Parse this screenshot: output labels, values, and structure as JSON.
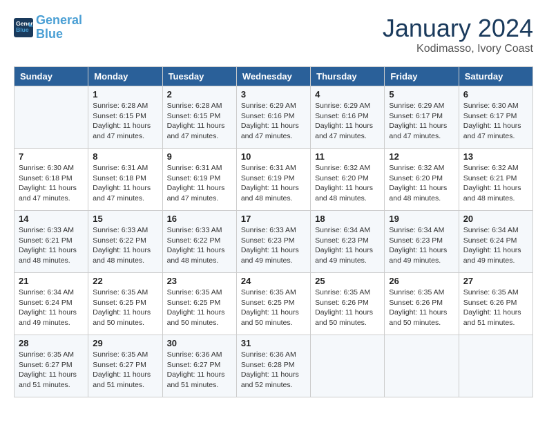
{
  "header": {
    "logo_line1": "General",
    "logo_line2": "Blue",
    "month": "January 2024",
    "location": "Kodimasso, Ivory Coast"
  },
  "weekdays": [
    "Sunday",
    "Monday",
    "Tuesday",
    "Wednesday",
    "Thursday",
    "Friday",
    "Saturday"
  ],
  "weeks": [
    [
      {
        "day": "",
        "info": ""
      },
      {
        "day": "1",
        "info": "Sunrise: 6:28 AM\nSunset: 6:15 PM\nDaylight: 11 hours\nand 47 minutes."
      },
      {
        "day": "2",
        "info": "Sunrise: 6:28 AM\nSunset: 6:15 PM\nDaylight: 11 hours\nand 47 minutes."
      },
      {
        "day": "3",
        "info": "Sunrise: 6:29 AM\nSunset: 6:16 PM\nDaylight: 11 hours\nand 47 minutes."
      },
      {
        "day": "4",
        "info": "Sunrise: 6:29 AM\nSunset: 6:16 PM\nDaylight: 11 hours\nand 47 minutes."
      },
      {
        "day": "5",
        "info": "Sunrise: 6:29 AM\nSunset: 6:17 PM\nDaylight: 11 hours\nand 47 minutes."
      },
      {
        "day": "6",
        "info": "Sunrise: 6:30 AM\nSunset: 6:17 PM\nDaylight: 11 hours\nand 47 minutes."
      }
    ],
    [
      {
        "day": "7",
        "info": "Sunrise: 6:30 AM\nSunset: 6:18 PM\nDaylight: 11 hours\nand 47 minutes."
      },
      {
        "day": "8",
        "info": "Sunrise: 6:31 AM\nSunset: 6:18 PM\nDaylight: 11 hours\nand 47 minutes."
      },
      {
        "day": "9",
        "info": "Sunrise: 6:31 AM\nSunset: 6:19 PM\nDaylight: 11 hours\nand 47 minutes."
      },
      {
        "day": "10",
        "info": "Sunrise: 6:31 AM\nSunset: 6:19 PM\nDaylight: 11 hours\nand 48 minutes."
      },
      {
        "day": "11",
        "info": "Sunrise: 6:32 AM\nSunset: 6:20 PM\nDaylight: 11 hours\nand 48 minutes."
      },
      {
        "day": "12",
        "info": "Sunrise: 6:32 AM\nSunset: 6:20 PM\nDaylight: 11 hours\nand 48 minutes."
      },
      {
        "day": "13",
        "info": "Sunrise: 6:32 AM\nSunset: 6:21 PM\nDaylight: 11 hours\nand 48 minutes."
      }
    ],
    [
      {
        "day": "14",
        "info": "Sunrise: 6:33 AM\nSunset: 6:21 PM\nDaylight: 11 hours\nand 48 minutes."
      },
      {
        "day": "15",
        "info": "Sunrise: 6:33 AM\nSunset: 6:22 PM\nDaylight: 11 hours\nand 48 minutes."
      },
      {
        "day": "16",
        "info": "Sunrise: 6:33 AM\nSunset: 6:22 PM\nDaylight: 11 hours\nand 48 minutes."
      },
      {
        "day": "17",
        "info": "Sunrise: 6:33 AM\nSunset: 6:23 PM\nDaylight: 11 hours\nand 49 minutes."
      },
      {
        "day": "18",
        "info": "Sunrise: 6:34 AM\nSunset: 6:23 PM\nDaylight: 11 hours\nand 49 minutes."
      },
      {
        "day": "19",
        "info": "Sunrise: 6:34 AM\nSunset: 6:23 PM\nDaylight: 11 hours\nand 49 minutes."
      },
      {
        "day": "20",
        "info": "Sunrise: 6:34 AM\nSunset: 6:24 PM\nDaylight: 11 hours\nand 49 minutes."
      }
    ],
    [
      {
        "day": "21",
        "info": "Sunrise: 6:34 AM\nSunset: 6:24 PM\nDaylight: 11 hours\nand 49 minutes."
      },
      {
        "day": "22",
        "info": "Sunrise: 6:35 AM\nSunset: 6:25 PM\nDaylight: 11 hours\nand 50 minutes."
      },
      {
        "day": "23",
        "info": "Sunrise: 6:35 AM\nSunset: 6:25 PM\nDaylight: 11 hours\nand 50 minutes."
      },
      {
        "day": "24",
        "info": "Sunrise: 6:35 AM\nSunset: 6:25 PM\nDaylight: 11 hours\nand 50 minutes."
      },
      {
        "day": "25",
        "info": "Sunrise: 6:35 AM\nSunset: 6:26 PM\nDaylight: 11 hours\nand 50 minutes."
      },
      {
        "day": "26",
        "info": "Sunrise: 6:35 AM\nSunset: 6:26 PM\nDaylight: 11 hours\nand 50 minutes."
      },
      {
        "day": "27",
        "info": "Sunrise: 6:35 AM\nSunset: 6:26 PM\nDaylight: 11 hours\nand 51 minutes."
      }
    ],
    [
      {
        "day": "28",
        "info": "Sunrise: 6:35 AM\nSunset: 6:27 PM\nDaylight: 11 hours\nand 51 minutes."
      },
      {
        "day": "29",
        "info": "Sunrise: 6:35 AM\nSunset: 6:27 PM\nDaylight: 11 hours\nand 51 minutes."
      },
      {
        "day": "30",
        "info": "Sunrise: 6:36 AM\nSunset: 6:27 PM\nDaylight: 11 hours\nand 51 minutes."
      },
      {
        "day": "31",
        "info": "Sunrise: 6:36 AM\nSunset: 6:28 PM\nDaylight: 11 hours\nand 52 minutes."
      },
      {
        "day": "",
        "info": ""
      },
      {
        "day": "",
        "info": ""
      },
      {
        "day": "",
        "info": ""
      }
    ]
  ]
}
